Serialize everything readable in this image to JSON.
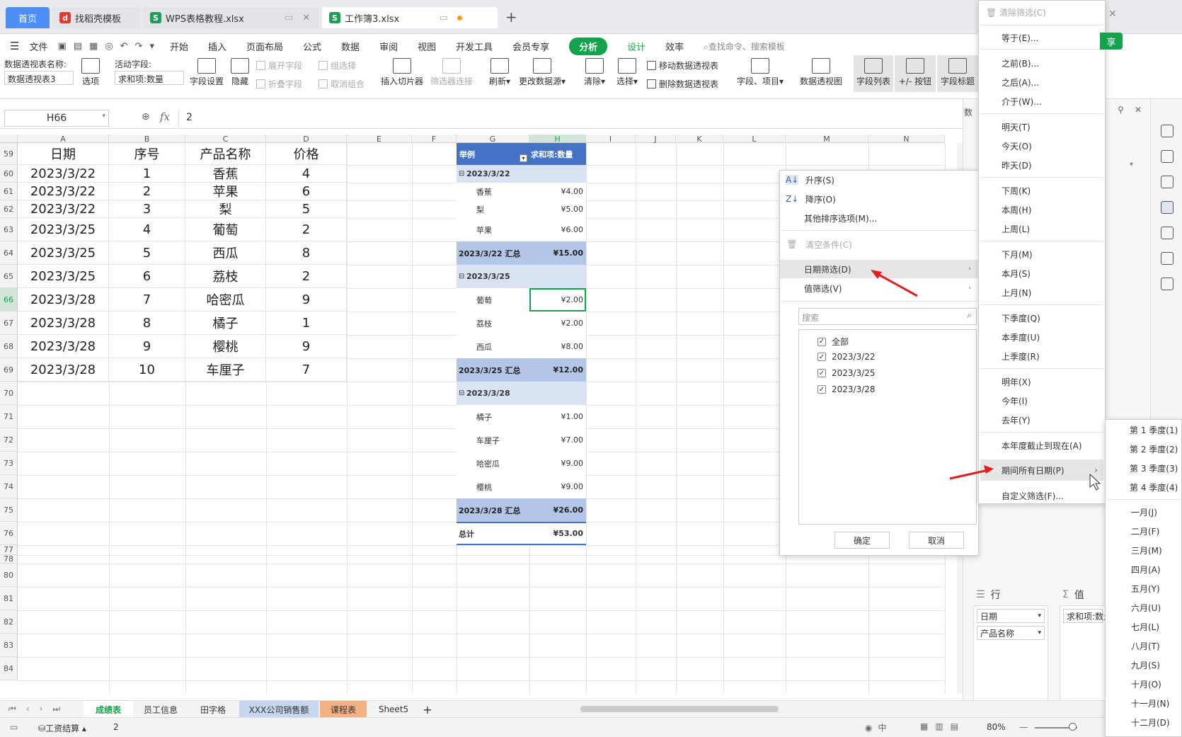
{
  "tabs": {
    "home": "首页",
    "t1": "找稻壳模板",
    "t2": "WPS表格教程.xlsx",
    "t3": "工作簿3.xlsx",
    "plus": "+"
  },
  "menu": [
    "文件",
    "开始",
    "插入",
    "页面布局",
    "公式",
    "数据",
    "审阅",
    "视图",
    "开发工具",
    "会员专享",
    "分析",
    "设计",
    "效率"
  ],
  "search_hint": "查找命令、搜索模板",
  "share": "享",
  "ribbon": {
    "pt_name_label": "数据透视表名称:",
    "pt_name_value": "数据透视表3",
    "options": "选项",
    "active_label": "活动字段:",
    "active_value": "求和项:数量",
    "field_settings": "字段设置",
    "hide": "隐藏",
    "expand": "展开字段",
    "collapse": "折叠字段",
    "group": "组选择",
    "ungroup": "取消组合",
    "insert_slicer": "插入切片器",
    "filter_conn": "筛选器连接",
    "refresh": "刷新",
    "change_source": "更改数据源",
    "clear": "清除",
    "select": "选择",
    "move_pt": "移动数据透视表",
    "delete_pt": "删除数据透视表",
    "fields_items": "字段、项目",
    "pivot_chart": "数据透视图",
    "field_list": "字段列表",
    "plus_minus": "+/- 按钮",
    "field_header": "字段标题"
  },
  "formula": {
    "cell": "H66",
    "fx": "fx",
    "value": "2"
  },
  "cols": [
    "A",
    "B",
    "C",
    "D",
    "E",
    "F",
    "G",
    "H",
    "I",
    "J",
    "K",
    "L",
    "M",
    "N"
  ],
  "rows": [
    "59",
    "60",
    "61",
    "62",
    "63",
    "64",
    "65",
    "66",
    "67",
    "68",
    "69",
    "70",
    "71",
    "72",
    "73",
    "74",
    "75",
    "76",
    "77",
    "78",
    "80",
    "81",
    "82",
    "83",
    "84"
  ],
  "headers": [
    "日期",
    "序号",
    "产品名称",
    "价格"
  ],
  "data": [
    [
      "2023/3/22",
      "1",
      "香蕉",
      "4"
    ],
    [
      "2023/3/22",
      "2",
      "苹果",
      "6"
    ],
    [
      "2023/3/22",
      "3",
      "梨",
      "5"
    ],
    [
      "2023/3/25",
      "4",
      "葡萄",
      "2"
    ],
    [
      "2023/3/25",
      "5",
      "西瓜",
      "8"
    ],
    [
      "2023/3/25",
      "6",
      "荔枝",
      "2"
    ],
    [
      "2023/3/28",
      "7",
      "哈密瓜",
      "9"
    ],
    [
      "2023/3/28",
      "8",
      "橘子",
      "1"
    ],
    [
      "2023/3/28",
      "9",
      "樱桃",
      "9"
    ],
    [
      "2023/3/28",
      "10",
      "车厘子",
      "7"
    ]
  ],
  "pivot": {
    "h1": "举例",
    "h2": "求和项:数量",
    "g1": "2023/3/22",
    "g1items": [
      [
        "香蕉",
        "¥4.00"
      ],
      [
        "梨",
        "¥5.00"
      ],
      [
        "苹果",
        "¥6.00"
      ]
    ],
    "g1sum": [
      "2023/3/22 汇总",
      "¥15.00"
    ],
    "g2": "2023/3/25",
    "g2items": [
      [
        "葡萄",
        "¥2.00"
      ],
      [
        "荔枝",
        "¥2.00"
      ],
      [
        "西瓜",
        "¥8.00"
      ]
    ],
    "g2sum": [
      "2023/3/25 汇总",
      "¥12.00"
    ],
    "g3": "2023/3/28",
    "g3items": [
      [
        "橘子",
        "¥1.00"
      ],
      [
        "车厘子",
        "¥7.00"
      ],
      [
        "哈密瓜",
        "¥9.00"
      ],
      [
        "樱桃",
        "¥9.00"
      ]
    ],
    "g3sum": [
      "2023/3/28 汇总",
      "¥26.00"
    ],
    "total": [
      "总计",
      "¥53.00"
    ]
  },
  "dropdown": {
    "asc": "升序(S)",
    "desc": "降序(O)",
    "more_sort": "其他排序选项(M)...",
    "clear": "清空条件(C)",
    "date_filter": "日期筛选(D)",
    "value_filter": "值筛选(V)",
    "search": "搜索",
    "all": "全部",
    "items": [
      "2023/3/22",
      "2023/3/25",
      "2023/3/28"
    ],
    "ok": "确定",
    "cancel": "取消"
  },
  "datemenu": {
    "clear": "清除筛选(C)",
    "g1": [
      "等于(E)..."
    ],
    "g2": [
      "之前(B)...",
      "之后(A)...",
      "介于(W)..."
    ],
    "g3": [
      "明天(T)",
      "今天(O)",
      "昨天(D)"
    ],
    "g4": [
      "下周(K)",
      "本周(H)",
      "上周(L)"
    ],
    "g5": [
      "下月(M)",
      "本月(S)",
      "上月(N)"
    ],
    "g6": [
      "下季度(Q)",
      "本季度(U)",
      "上季度(R)"
    ],
    "g7": [
      "明年(X)",
      "今年(I)",
      "去年(Y)"
    ],
    "ytd": "本年度截止到现在(A)",
    "all_dates": "期间所有日期(P)",
    "custom": "自定义筛选(F)..."
  },
  "periods": [
    "第 1 季度(1)",
    "第 2 季度(2)",
    "第 3 季度(3)",
    "第 4 季度(4)",
    "一月(J)",
    "二月(F)",
    "三月(M)",
    "四月(A)",
    "五月(Y)",
    "六月(U)",
    "七月(L)",
    "八月(T)",
    "九月(S)",
    "十月(O)",
    "十一月(N)",
    "十二月(D)"
  ],
  "panel": {
    "rows_label": "行",
    "values_label": "值",
    "row_fields": [
      "日期",
      "产品名称"
    ],
    "value_field": "求和项:数量"
  },
  "sheets": [
    "成绩表",
    "员工信息",
    "田字格",
    "XXX公司销售额",
    "课程表",
    "Sheet5"
  ],
  "status": {
    "macro": "工资结算",
    "count": "2",
    "zoom": "80%"
  },
  "colors": {
    "accent": "#14a34c",
    "pivot_header": "#4472c4",
    "pivot_subtotal": "#b4c6e7",
    "pivot_group": "#dae3f3",
    "arrow": "#e02020"
  }
}
